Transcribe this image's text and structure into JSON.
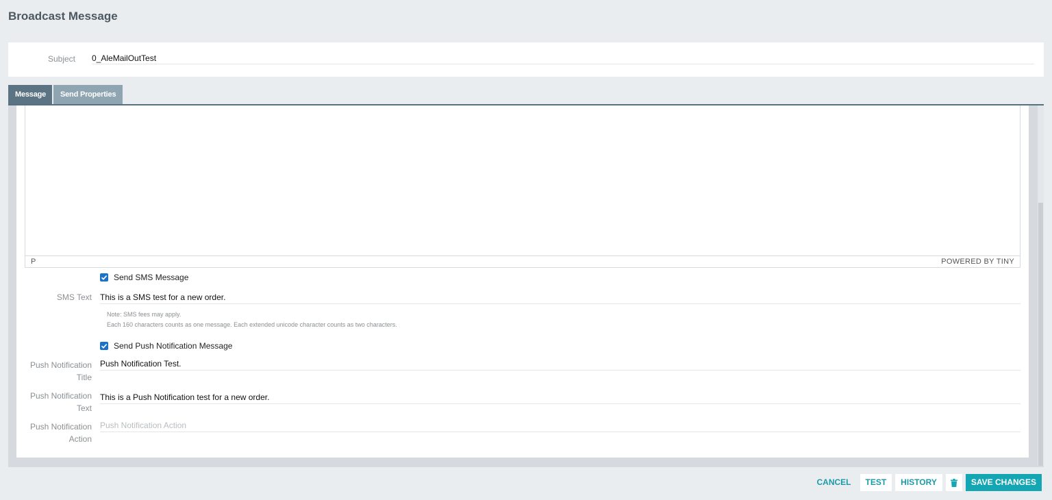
{
  "page": {
    "title": "Broadcast Message"
  },
  "subject": {
    "label": "Subject",
    "value": "0_AleMailOutTest"
  },
  "tabs": [
    {
      "label": "Message",
      "active": true
    },
    {
      "label": "Send Properties",
      "active": false
    }
  ],
  "editor": {
    "status_path": "P",
    "brand": "POWERED BY TINY"
  },
  "sms": {
    "checkbox_label": "Send SMS Message",
    "checked": true,
    "text_label": "SMS Text",
    "text_value": "This is a SMS test for a new order.",
    "note_line1": "Note: SMS fees may apply.",
    "note_line2": "Each 160 characters counts as one message. Each extended unicode character counts as two characters."
  },
  "push": {
    "checkbox_label": "Send Push Notification Message",
    "checked": true,
    "title_label_1": "Push Notification",
    "title_label_2": "Title",
    "title_value": "Push Notification Test.",
    "text_label_1": "Push Notification",
    "text_label_2": "Text",
    "text_value": "This is a Push Notification test for a new order.",
    "action_label_1": "Push Notification",
    "action_label_2": "Action",
    "action_placeholder": "Push Notification Action"
  },
  "actions": {
    "cancel": "CANCEL",
    "test": "TEST",
    "history": "HISTORY",
    "delete_icon": "trash-icon",
    "save": "SAVE CHANGES"
  },
  "colors": {
    "background": "#e9edf0",
    "tab_active": "#5b7382",
    "tab_inactive": "#8fa5b2",
    "accent": "#14a6b2",
    "checkbox": "#1a73c8"
  }
}
